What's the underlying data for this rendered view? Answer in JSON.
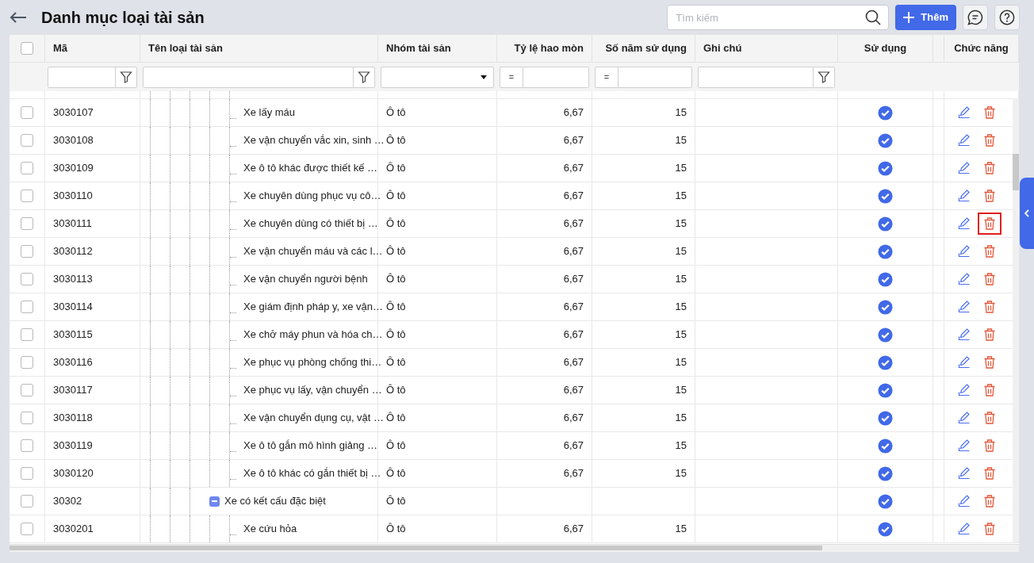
{
  "header": {
    "title": "Danh mục loại tài sản",
    "search": {
      "placeholder": "Tìm kiếm"
    },
    "add_button": "Thêm"
  },
  "table": {
    "columns": [
      {
        "kind": "check",
        "checked": false
      },
      {
        "kind": "text",
        "label": "Mã"
      },
      {
        "kind": "text",
        "label": "Tên loại tài sản"
      },
      {
        "kind": "text",
        "label": "Nhóm tài sản"
      },
      {
        "kind": "num",
        "label": "Tỷ lệ hao mòn"
      },
      {
        "kind": "num",
        "label": "Số năm sử dụng"
      },
      {
        "kind": "text",
        "label": "Ghi chú"
      },
      {
        "kind": "center",
        "label": "Sử dụng"
      },
      {
        "kind": "cut"
      },
      {
        "kind": "center",
        "label": "Chức năng"
      }
    ],
    "filters": [
      {
        "kind": "none"
      },
      {
        "kind": "text"
      },
      {
        "kind": "text"
      },
      {
        "kind": "select"
      },
      {
        "kind": "op",
        "operator": "="
      },
      {
        "kind": "op",
        "operator": "="
      },
      {
        "kind": "text"
      },
      {
        "kind": "none"
      },
      {
        "kind": "none"
      },
      {
        "kind": "none"
      }
    ],
    "rows": [
      {
        "kind": "leaf",
        "code": "3030107",
        "name": "Xe lấy máu",
        "group": "Ô tô",
        "rate": "6,67",
        "years": "15",
        "used": true,
        "checked": false,
        "highlighted": false
      },
      {
        "kind": "leaf",
        "code": "3030108",
        "name": "Xe vận chuyển vắc xin, sinh …",
        "group": "Ô tô",
        "rate": "6,67",
        "years": "15",
        "used": true,
        "checked": false,
        "highlighted": false
      },
      {
        "kind": "leaf",
        "code": "3030109",
        "name": "Xe ô tô khác được thiết kế …",
        "group": "Ô tô",
        "rate": "6,67",
        "years": "15",
        "used": true,
        "checked": false,
        "highlighted": false
      },
      {
        "kind": "leaf",
        "code": "3030110",
        "name": "Xe chuyên dùng phục vụ cô…",
        "group": "Ô tô",
        "rate": "6,67",
        "years": "15",
        "used": true,
        "checked": false,
        "highlighted": false
      },
      {
        "kind": "leaf",
        "code": "3030111",
        "name": "Xe chuyên dùng có thiết bị …",
        "group": "Ô tô",
        "rate": "6,67",
        "years": "15",
        "used": true,
        "checked": false,
        "highlighted": true
      },
      {
        "kind": "leaf",
        "code": "3030112",
        "name": "Xe vận chuyển máu và các l…",
        "group": "Ô tô",
        "rate": "6,67",
        "years": "15",
        "used": true,
        "checked": false,
        "highlighted": false
      },
      {
        "kind": "leaf",
        "code": "3030113",
        "name": "Xe vận chuyển người bệnh",
        "group": "Ô tô",
        "rate": "6,67",
        "years": "15",
        "used": true,
        "checked": false,
        "highlighted": false
      },
      {
        "kind": "leaf",
        "code": "3030114",
        "name": "Xe giám định pháp y, xe vận…",
        "group": "Ô tô",
        "rate": "6,67",
        "years": "15",
        "used": true,
        "checked": false,
        "highlighted": false
      },
      {
        "kind": "leaf",
        "code": "3030115",
        "name": "Xe chở máy phun và hóa ch…",
        "group": "Ô tô",
        "rate": "6,67",
        "years": "15",
        "used": true,
        "checked": false,
        "highlighted": false
      },
      {
        "kind": "leaf",
        "code": "3030116",
        "name": "Xe phục vụ phòng chống thi…",
        "group": "Ô tô",
        "rate": "6,67",
        "years": "15",
        "used": true,
        "checked": false,
        "highlighted": false
      },
      {
        "kind": "leaf",
        "code": "3030117",
        "name": "Xe phục vụ lấy, vận chuyển …",
        "group": "Ô tô",
        "rate": "6,67",
        "years": "15",
        "used": true,
        "checked": false,
        "highlighted": false
      },
      {
        "kind": "leaf",
        "code": "3030118",
        "name": "Xe vận chuyển dụng cụ, vật …",
        "group": "Ô tô",
        "rate": "6,67",
        "years": "15",
        "used": true,
        "checked": false,
        "highlighted": false
      },
      {
        "kind": "leaf",
        "code": "3030119",
        "name": "Xe ô tô gắn mô hình giảng …",
        "group": "Ô tô",
        "rate": "6,67",
        "years": "15",
        "used": true,
        "checked": false,
        "highlighted": false
      },
      {
        "kind": "leaf",
        "code": "3030120",
        "name": "Xe ô tô khác có gắn thiết bị …",
        "group": "Ô tô",
        "rate": "6,67",
        "years": "15",
        "used": true,
        "checked": false,
        "highlighted": false
      },
      {
        "kind": "group",
        "code": "30302",
        "name": "Xe có kết cấu đặc biệt",
        "group": "Ô tô",
        "used": true,
        "checked": false,
        "highlighted": false,
        "expanded": true,
        "children": [
          {
            "kind": "leaf",
            "code": "3030201",
            "name": "Xe cứu hỏa",
            "group": "Ô tô",
            "rate": "6,67",
            "years": "15",
            "used": true,
            "checked": false,
            "highlighted": false
          }
        ]
      }
    ]
  }
}
